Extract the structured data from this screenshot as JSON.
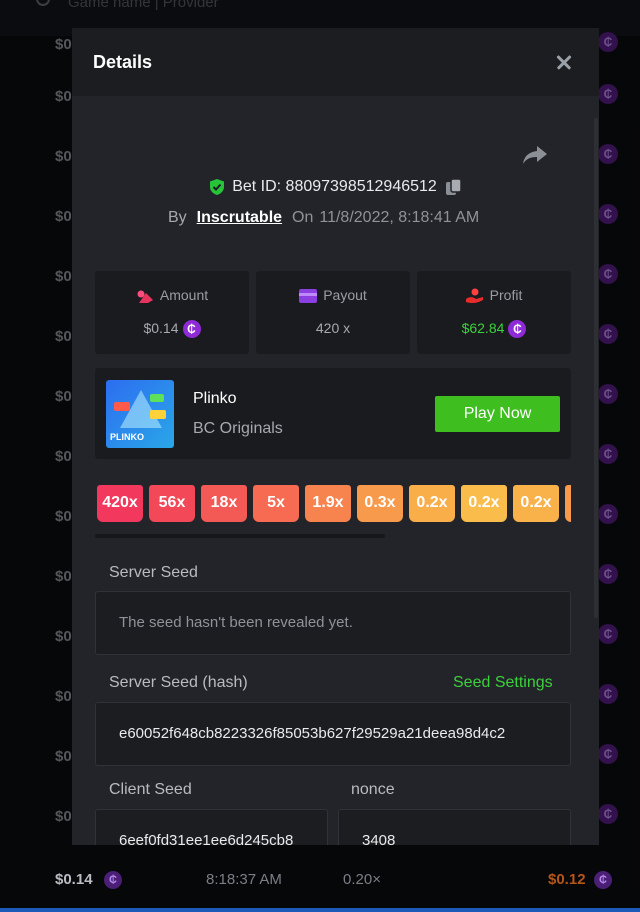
{
  "background": {
    "search_placeholder": "Game name | Provider",
    "row_amount": "$0.",
    "coin_symbol": "₵",
    "bottom_row": {
      "amount": "$0.14",
      "time": "8:18:37 AM",
      "multiplier": "0.20×",
      "profit": "$0.12"
    }
  },
  "modal": {
    "title": "Details",
    "bet": {
      "label": "Bet ID: 88097398512946512",
      "by": "By",
      "user": "Inscrutable",
      "on": "On",
      "date": "11/8/2022, 8:18:41 AM"
    },
    "stats": {
      "amount": {
        "label": "Amount",
        "value": "$0.14"
      },
      "payout": {
        "label": "Payout",
        "value": "420 x"
      },
      "profit": {
        "label": "Profit",
        "value": "$62.84"
      }
    },
    "game": {
      "name": "Plinko",
      "provider": "BC Originals",
      "thumb_logo": "PLINKO",
      "play_label": "Play Now"
    },
    "multipliers": [
      {
        "label": "420x",
        "color": "#f2385d"
      },
      {
        "label": "56x",
        "color": "#f24858"
      },
      {
        "label": "18x",
        "color": "#f45a55"
      },
      {
        "label": "5x",
        "color": "#f66b52"
      },
      {
        "label": "1.9x",
        "color": "#f7834f"
      },
      {
        "label": "0.3x",
        "color": "#f89a4c"
      },
      {
        "label": "0.2x",
        "color": "#f9ae4a"
      },
      {
        "label": "0.2x",
        "color": "#fabd4b"
      },
      {
        "label": "0.2x",
        "color": "#f9b14a"
      },
      {
        "label": "",
        "color": "#f89a4c"
      }
    ],
    "server_seed": {
      "label": "Server Seed",
      "value": "The seed hasn't been revealed yet."
    },
    "server_seed_hash": {
      "label": "Server Seed (hash)",
      "link": "Seed Settings",
      "value": "e60052f648cb8223326f85053b627f29529a21deea98d4c2"
    },
    "client_seed": {
      "label": "Client Seed",
      "value": "6eef0fd31ee1ee6d245cb8"
    },
    "nonce": {
      "label": "nonce",
      "value": "3408"
    }
  }
}
